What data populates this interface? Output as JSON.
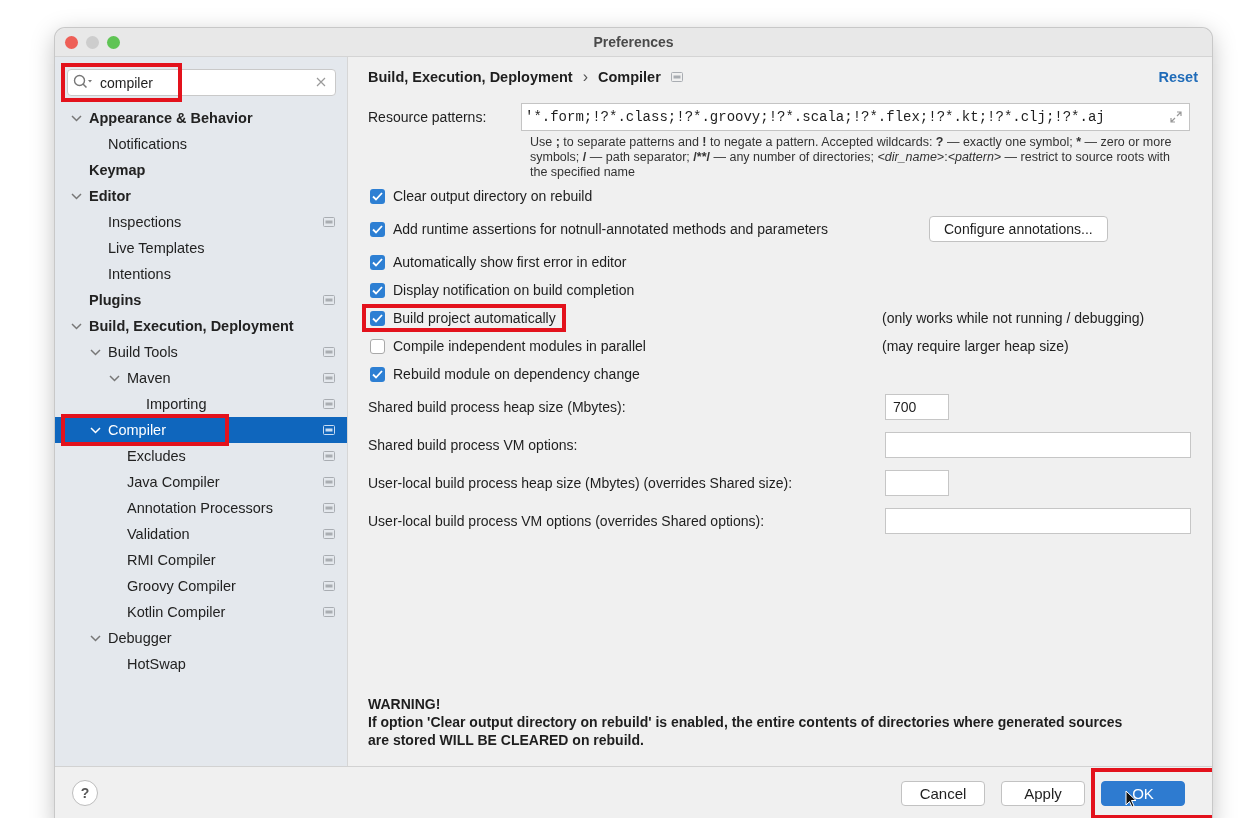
{
  "window": {
    "title": "Preferences",
    "traffic_lights": [
      {
        "color": "#ee5f57"
      },
      {
        "color": "#cdcdcd"
      },
      {
        "color": "#5fc454"
      }
    ]
  },
  "search": {
    "value": "compiler",
    "highlighted": true
  },
  "tree": [
    {
      "label": "Appearance & Behavior",
      "expanded": true,
      "scoped": false,
      "selected": false,
      "highlighted": false,
      "children": [
        {
          "label": "Notifications",
          "scoped": false,
          "selected": false,
          "highlighted": false
        }
      ]
    },
    {
      "label": "Keymap",
      "scoped": false,
      "selected": false,
      "highlighted": false
    },
    {
      "label": "Editor",
      "expanded": true,
      "scoped": false,
      "selected": false,
      "highlighted": false,
      "children": [
        {
          "label": "Inspections",
          "scoped": true,
          "selected": false,
          "highlighted": false
        },
        {
          "label": "Live Templates",
          "scoped": false,
          "selected": false,
          "highlighted": false
        },
        {
          "label": "Intentions",
          "scoped": false,
          "selected": false,
          "highlighted": false
        }
      ]
    },
    {
      "label": "Plugins",
      "scoped": true,
      "selected": false,
      "highlighted": false
    },
    {
      "label": "Build, Execution, Deployment",
      "expanded": true,
      "scoped": false,
      "selected": false,
      "highlighted": false,
      "children": [
        {
          "label": "Build Tools",
          "expanded": true,
          "scoped": true,
          "selected": false,
          "highlighted": false,
          "children": [
            {
              "label": "Maven",
              "expanded": true,
              "scoped": true,
              "selected": false,
              "highlighted": false,
              "children": [
                {
                  "label": "Importing",
                  "scoped": true,
                  "selected": false,
                  "highlighted": false
                }
              ]
            }
          ]
        },
        {
          "label": "Compiler",
          "expanded": true,
          "scoped": true,
          "selected": true,
          "highlighted": true,
          "children": [
            {
              "label": "Excludes",
              "scoped": true,
              "selected": false,
              "highlighted": false
            },
            {
              "label": "Java Compiler",
              "scoped": true,
              "selected": false,
              "highlighted": false
            },
            {
              "label": "Annotation Processors",
              "scoped": true,
              "selected": false,
              "highlighted": false
            },
            {
              "label": "Validation",
              "scoped": true,
              "selected": false,
              "highlighted": false
            },
            {
              "label": "RMI Compiler",
              "scoped": true,
              "selected": false,
              "highlighted": false
            },
            {
              "label": "Groovy Compiler",
              "scoped": true,
              "selected": false,
              "highlighted": false
            },
            {
              "label": "Kotlin Compiler",
              "scoped": true,
              "selected": false,
              "highlighted": false
            }
          ]
        },
        {
          "label": "Debugger",
          "expanded": true,
          "scoped": false,
          "selected": false,
          "highlighted": false,
          "children": [
            {
              "label": "HotSwap",
              "scoped": false,
              "selected": false,
              "highlighted": false
            }
          ]
        }
      ]
    }
  ],
  "breadcrumb": {
    "items": [
      "Build, Execution, Deployment",
      "Compiler"
    ],
    "separator": "›"
  },
  "reset": "Reset",
  "resource_patterns": {
    "label": "Resource patterns:",
    "value": "'*.form;!?*.class;!?*.groovy;!?*.scala;!?*.flex;!?*.kt;!?*.clj;!?*.aj",
    "help": [
      {
        "text": "Use ",
        "kind": "prose"
      },
      {
        "text": ";",
        "kind": "symbol"
      },
      {
        "text": " to separate patterns and ",
        "kind": "prose"
      },
      {
        "text": "!",
        "kind": "symbol"
      },
      {
        "text": " to negate a pattern. Accepted wildcards: ",
        "kind": "prose"
      },
      {
        "text": "?",
        "kind": "symbol"
      },
      {
        "text": " — exactly one symbol; ",
        "kind": "prose"
      },
      {
        "text": "*",
        "kind": "symbol"
      },
      {
        "text": " — zero or more symbols; ",
        "kind": "prose"
      },
      {
        "text": "/",
        "kind": "symbol"
      },
      {
        "text": " — path separator; ",
        "kind": "prose"
      },
      {
        "text": "/**/",
        "kind": "symbol"
      },
      {
        "text": " — any number of directories; ",
        "kind": "prose"
      },
      {
        "text": "<dir_name>",
        "kind": "variable"
      },
      {
        "text": ":",
        "kind": "prose"
      },
      {
        "text": "<pattern>",
        "kind": "variable"
      },
      {
        "text": " — restrict to source roots with the specified name",
        "kind": "prose"
      }
    ]
  },
  "checkboxes": [
    {
      "label": "Clear output directory on rebuild",
      "checked": true,
      "highlighted": false
    },
    {
      "label": "Add runtime assertions for notnull-annotated methods and parameters",
      "checked": true,
      "highlighted": false,
      "button": "Configure annotations..."
    },
    {
      "label": "Automatically show first error in editor",
      "checked": true,
      "highlighted": false
    },
    {
      "label": "Display notification on build completion",
      "checked": true,
      "highlighted": false
    },
    {
      "label": "Build project automatically",
      "checked": true,
      "highlighted": true,
      "note": "(only works while not running / debugging)"
    },
    {
      "label": "Compile independent modules in parallel",
      "checked": false,
      "highlighted": false,
      "note": "(may require larger heap size)"
    },
    {
      "label": "Rebuild module on dependency change",
      "checked": true,
      "highlighted": false
    }
  ],
  "fields": [
    {
      "label": "Shared build process heap size (Mbytes):",
      "kind": "short",
      "value": "700"
    },
    {
      "label": "Shared build process VM options:",
      "kind": "wide"
    },
    {
      "label": "User-local build process heap size (Mbytes) (overrides Shared size):",
      "kind": "short"
    },
    {
      "label": "User-local build process VM options (overrides Shared options):",
      "kind": "wide"
    }
  ],
  "warning": {
    "title": "WARNING!",
    "text": "If option 'Clear output directory on rebuild' is enabled, the entire contents of directories where generated sources are stored WILL BE CLEARED on rebuild."
  },
  "help_button": "?",
  "buttons": [
    {
      "label": "Cancel",
      "kind": "normal",
      "highlighted": false
    },
    {
      "label": "Apply",
      "kind": "normal",
      "highlighted": false
    },
    {
      "label": "OK",
      "kind": "default",
      "highlighted": true
    }
  ]
}
